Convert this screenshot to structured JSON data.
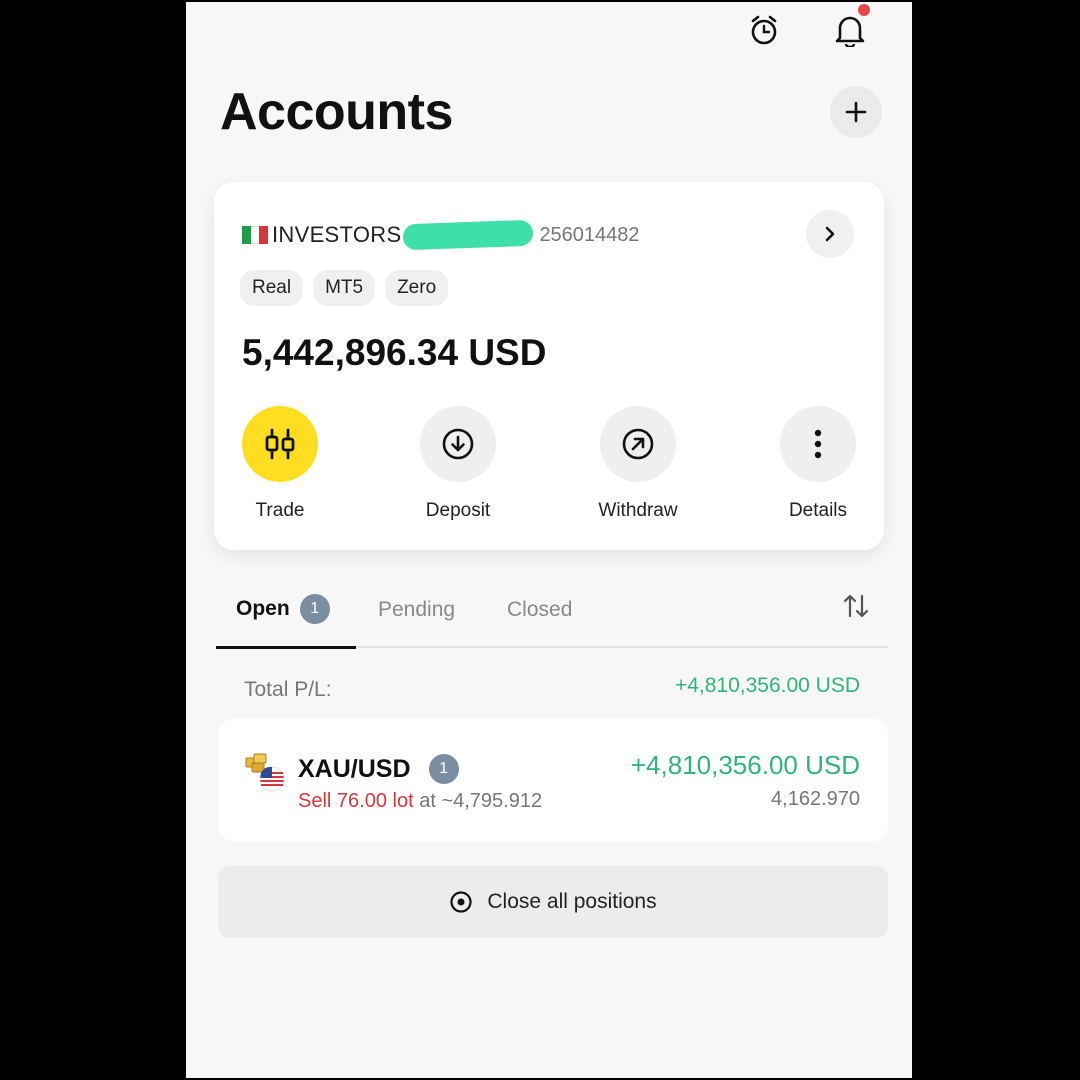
{
  "header": {
    "title": "Accounts",
    "icons": [
      "alarm-clock-icon",
      "bell-icon",
      "plus-icon"
    ]
  },
  "account": {
    "name": "INVESTORS",
    "number": "256014482",
    "flag": "italy-flag",
    "tags": [
      "Real",
      "MT5",
      "Zero"
    ],
    "balance": "5,442,896.34 USD",
    "actions": [
      {
        "label": "Trade",
        "icon": "candlestick-icon"
      },
      {
        "label": "Deposit",
        "icon": "arrow-down-circle-icon"
      },
      {
        "label": "Withdraw",
        "icon": "arrow-up-right-circle-icon"
      },
      {
        "label": "Details",
        "icon": "more-vertical-icon"
      }
    ]
  },
  "tabs": {
    "open": "Open",
    "open_count": "1",
    "pending": "Pending",
    "closed": "Closed"
  },
  "summary": {
    "total_label": "Total P/L:",
    "total_value": "+4,810,356.00 USD"
  },
  "position": {
    "symbol": "XAU/USD",
    "count": "1",
    "side_lot": "Sell 76.00 lot",
    "at_price": "at ~4,795.912",
    "pl": "+4,810,356.00 USD",
    "current_price": "4,162.970"
  },
  "close_all_label": "Close all positions",
  "colors": {
    "accent_yellow": "#ffde21",
    "profit_green": "#2fb57c",
    "sell_red": "#d23a3a",
    "notification_red": "#e5474b",
    "badge_gray": "#7b8da1"
  }
}
